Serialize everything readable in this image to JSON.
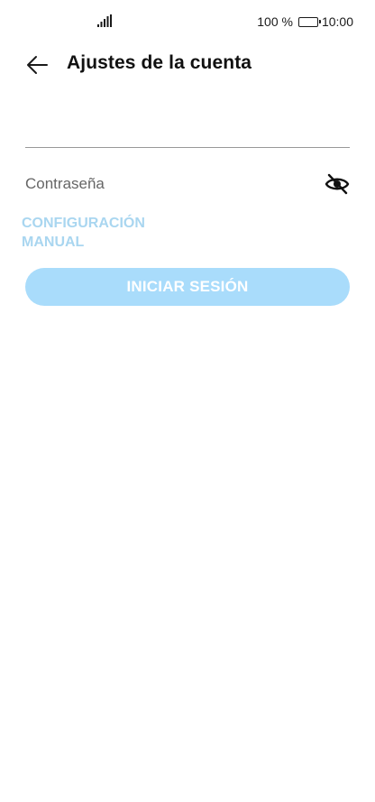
{
  "status_bar": {
    "battery_percent": "100 %",
    "time": "10:00",
    "signal_icon": "signal-bars-icon",
    "battery_icon": "battery-icon"
  },
  "header": {
    "title": "Ajustes de la cuenta",
    "back_icon": "arrow-left-icon"
  },
  "form": {
    "username_value": "",
    "password_placeholder": "Contraseña",
    "password_toggle_icon": "eye-hidden-icon",
    "manual_config_label": "CONFIGURACIÓN MANUAL",
    "login_label": "INICIAR SESIÓN"
  },
  "colors": {
    "accent_disabled": "#a9dcfb",
    "link_disabled": "#a9d6f0"
  }
}
